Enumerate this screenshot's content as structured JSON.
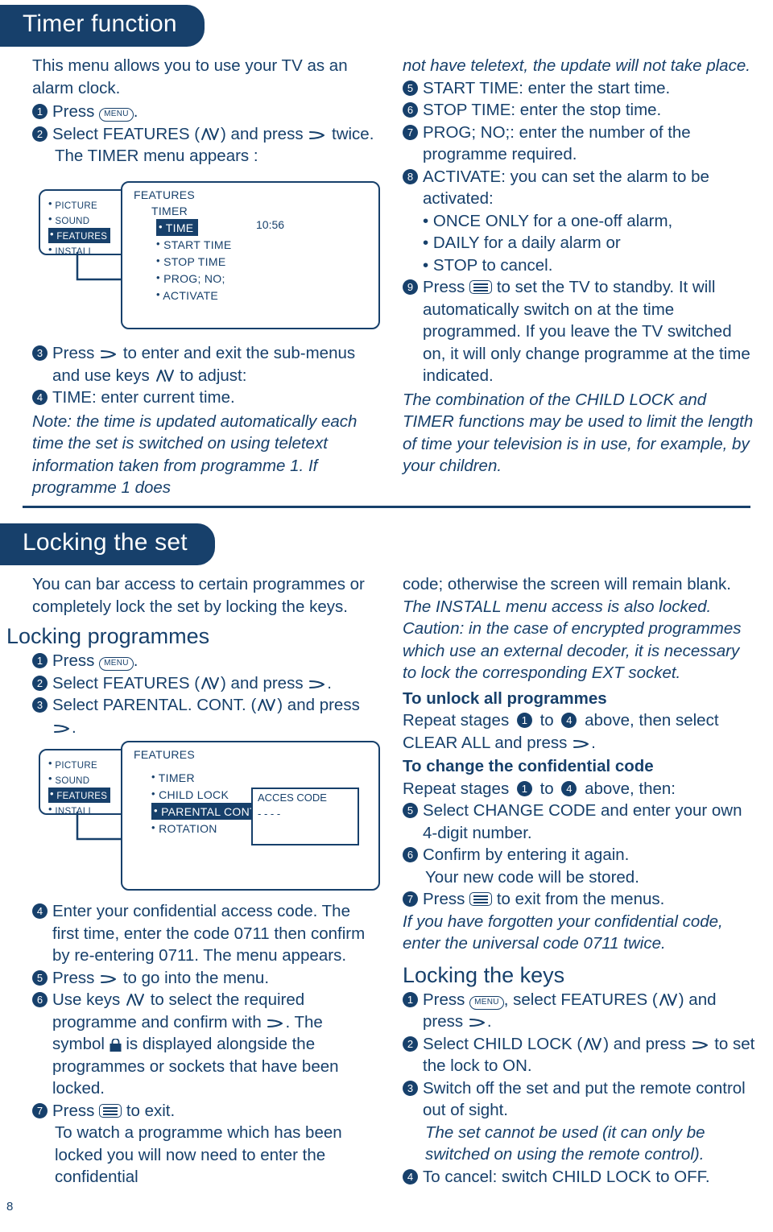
{
  "page": {
    "number": "8"
  },
  "sections": [
    {
      "title": "Timer function"
    },
    {
      "title": "Locking the set"
    }
  ],
  "timer": {
    "intro": "This menu allows you to use your TV as an alarm clock.",
    "step1": "Press",
    "step1_key": "MENU",
    "step1_end": ".",
    "step2": "Select FEATURES (",
    "step2_mid": ") and press",
    "step2_end": "twice.",
    "step2_note": "The TIMER menu appears :",
    "step3": "Press",
    "step3_mid": "to enter and exit the sub-menus and use keys",
    "step3_end": "to adjust:",
    "step4": "TIME: enter current time.",
    "note": "Note: the time is updated automatically each time the set is switched on using teletext information taken from programme 1. If programme 1 does not have teletext, the update will not take place.",
    "step5": "START TIME: enter the start time.",
    "step6": "STOP TIME: enter the stop time.",
    "step7": "PROG; NO;: enter the number of the programme required.",
    "step8": "ACTIVATE: you can set the alarm to be activated:",
    "step8_b1": "• ONCE ONLY for a one-off alarm,",
    "step8_b2": "• DAILY for a daily alarm or",
    "step8_b3": "• STOP to cancel.",
    "step9_a": "Press",
    "step9_b": "to set the TV to standby. It will automatically switch on at the time programmed. If you leave the TV switched on, it will only change programme at the time indicated.",
    "closing": "The combination of the CHILD LOCK and TIMER functions may be used to limit the length of time your television is in use, for example, by your children."
  },
  "osd_timer": {
    "left_items": [
      "PICTURE",
      "SOUND",
      "FEATURES",
      "INSTALL"
    ],
    "left_highlight": "FEATURES",
    "title": "FEATURES",
    "subtitle": "TIMER",
    "items": [
      "TIME",
      "START TIME",
      "STOP TIME",
      "PROG; NO;",
      "ACTIVATE"
    ],
    "highlight": "TIME",
    "clock": "10:56"
  },
  "locking": {
    "intro": "You can bar access to certain programmes or completely lock the set by locking the keys.",
    "sub1": "Locking programmes",
    "step1": "Press",
    "step1_key": "MENU",
    "step1_end": ".",
    "step2a": "Select FEATURES (",
    "step2b": ") and press",
    "step2c": ".",
    "step3a": "Select PARENTAL. CONT. (",
    "step3b": ") and press",
    "step3c": ".",
    "step4": "Enter your confidential access code. The first time, enter the code 0711 then confirm by re-entering 0711. The menu appears.",
    "step5a": "Press",
    "step5b": "to go into the menu.",
    "step6a": "Use keys",
    "step6b": "to select the required programme and confirm with",
    "step6c": ". The symbol",
    "step6d": "is displayed alongside the programmes or sockets that have been locked.",
    "step7a": "Press",
    "step7b": "to exit.",
    "tail": "To watch a programme which has been locked you will now need to enter the confidential code; otherwise the screen will remain blank.",
    "install_note": "The INSTALL menu access is also locked.",
    "caution": "Caution: in the case of encrypted programmes which use an external decoder, it is necessary to lock the corresponding EXT socket.",
    "unlock_title": "To unlock all programmes",
    "unlock_a": "Repeat stages",
    "unlock_b": "to",
    "unlock_c": "above, then select CLEAR ALL and press",
    "unlock_d": ".",
    "change_title": "To change the confidential code",
    "change_a": "Repeat stages",
    "change_b": "to",
    "change_c": "above, then:",
    "change5": "Select CHANGE CODE and enter your own 4-digit number.",
    "change6": "Confirm by entering it again.",
    "change6b": "Your new code will be stored.",
    "change7a": "Press",
    "change7b": "to exit from the menus.",
    "forgot": "If you have forgotten your confidential code, enter the universal code 0711 twice.",
    "keys_title": "Locking the keys",
    "k1a": "Press",
    "k1b": ", select FEATURES (",
    "k1c": ") and press",
    "k1d": ".",
    "k2a": "Select CHILD LOCK (",
    "k2b": ") and press",
    "k2c": "to set the lock to ON.",
    "k3": "Switch off the set and put the remote control out of sight.",
    "k3b": "The set cannot be used (it can only be switched on using the remote control).",
    "k4": "To cancel: switch CHILD LOCK to OFF."
  },
  "osd_lock": {
    "left_items": [
      "PICTURE",
      "SOUND",
      "FEATURES",
      "INSTALL"
    ],
    "left_highlight": "FEATURES",
    "title": "FEATURES",
    "items": [
      "TIMER",
      "CHILD LOCK",
      "PARENTAL CONT",
      "ROTATION"
    ],
    "highlight": "PARENTAL CONT",
    "acces_title": "ACCES CODE",
    "acces_value": "- - - -"
  }
}
